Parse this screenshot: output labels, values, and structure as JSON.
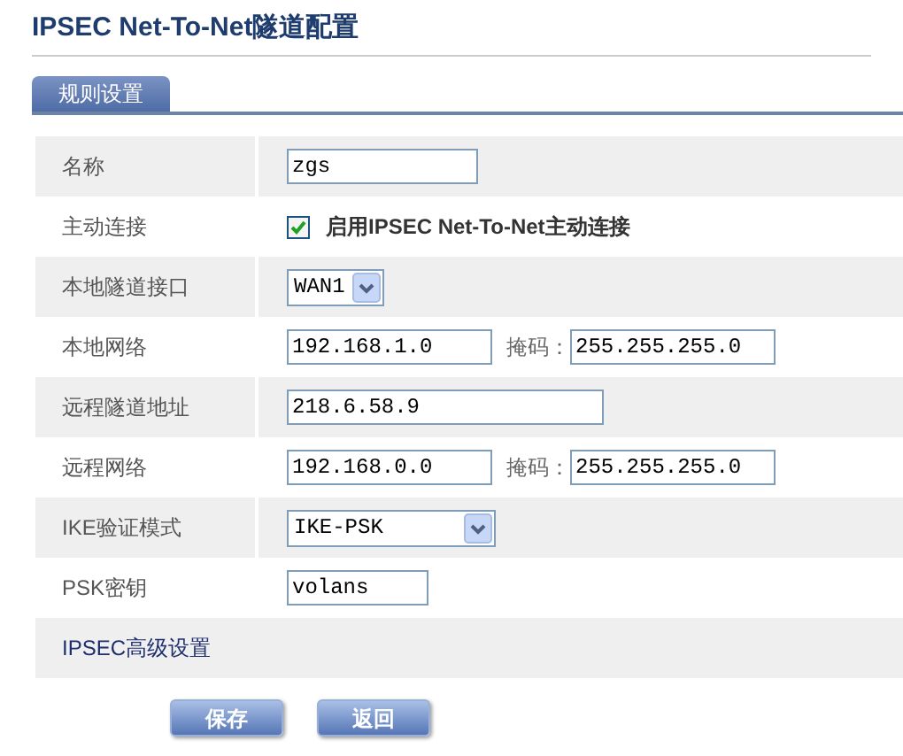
{
  "title": "IPSEC Net-To-Net隧道配置",
  "tabs": [
    {
      "label": "规则设置",
      "selected": true
    }
  ],
  "rows": [
    {
      "kind": "text",
      "label": "名称",
      "value": "zgs"
    },
    {
      "kind": "checkbox",
      "label": "主动连接",
      "text": "启用IPSEC Net-To-Net主动连接",
      "checked": true
    },
    {
      "kind": "select",
      "label": "本地隧道接口",
      "value": "WAN1"
    },
    {
      "kind": "network",
      "label": "本地网络",
      "value": "192.168.1.0",
      "mask_label": "掩码：",
      "mask": "255.255.255.0"
    },
    {
      "kind": "text",
      "label": "远程隧道地址",
      "value": "218.6.58.9"
    },
    {
      "kind": "network",
      "label": "远程网络",
      "value": "192.168.0.0",
      "mask_label": "掩码：",
      "mask": "255.255.255.0"
    },
    {
      "kind": "select",
      "label": "IKE验证模式",
      "value": "IKE-PSK"
    },
    {
      "kind": "text",
      "label": "PSK密钥",
      "value": "volans"
    }
  ],
  "advanced": {
    "label": "IPSEC高级设置"
  },
  "buttons": [
    "保存",
    "返回"
  ]
}
